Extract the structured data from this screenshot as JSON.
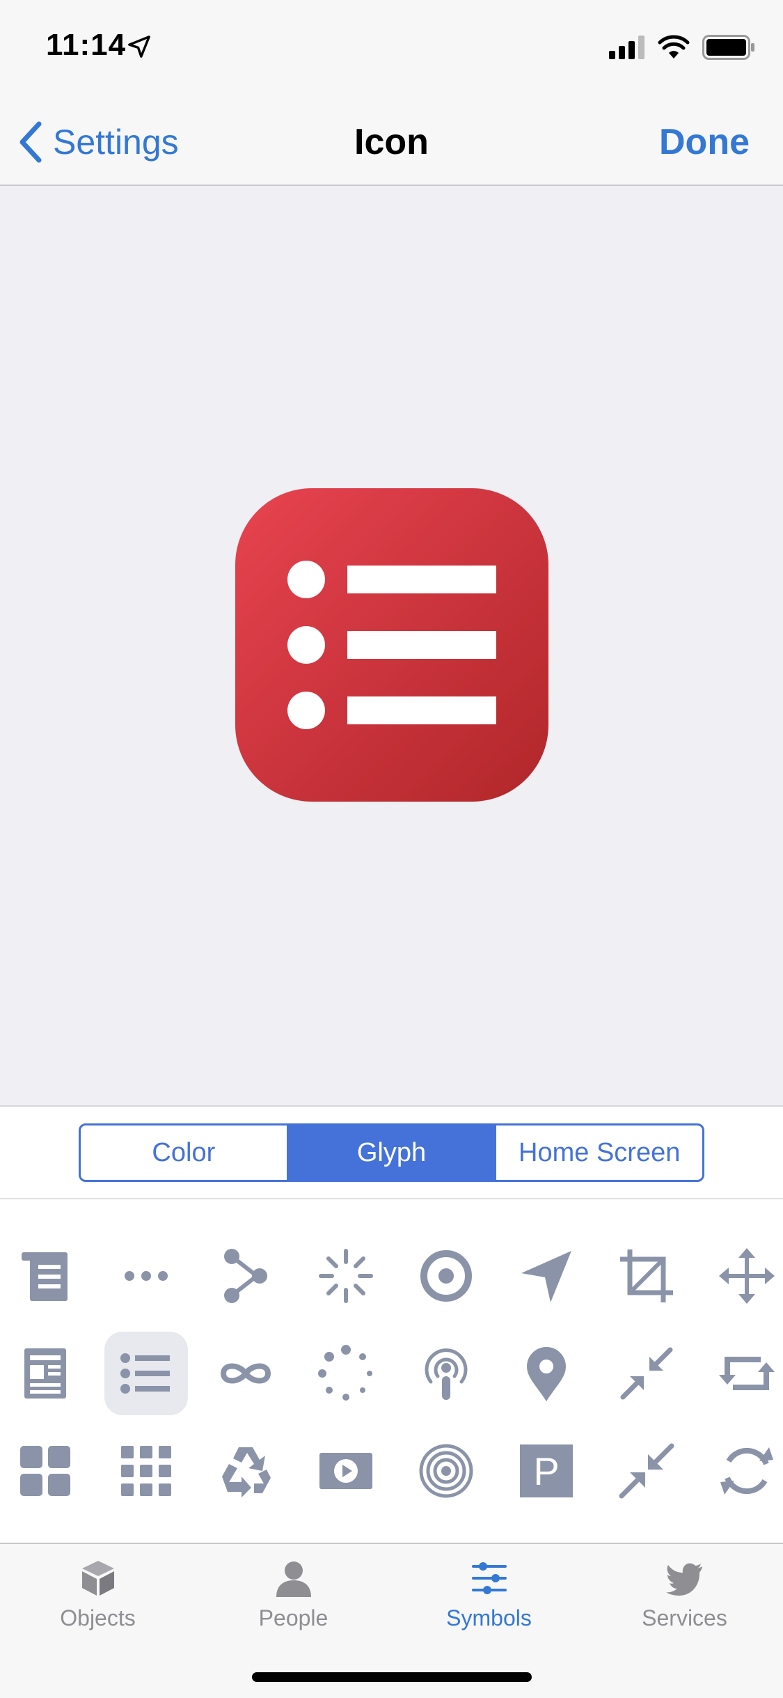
{
  "status": {
    "time": "11:14"
  },
  "nav": {
    "back_label": "Settings",
    "title": "Icon",
    "done_label": "Done"
  },
  "preview": {
    "icon_glyph": "list-bullet-icon",
    "gradient": [
      "#e84450",
      "#b0272a"
    ]
  },
  "segments": [
    {
      "label": "Color",
      "active": false
    },
    {
      "label": "Glyph",
      "active": true
    },
    {
      "label": "Home Screen",
      "active": false
    }
  ],
  "glyphs": [
    [
      "scroll-document-icon",
      "ellipsis-icon",
      "share-nodes-icon",
      "loading-spinner-icon",
      "target-icon",
      "location-arrow-icon",
      "crop-icon",
      "move-arrows-icon"
    ],
    [
      "newspaper-icon",
      "list-bullet-icon",
      "infinity-icon",
      "dotted-circle-icon",
      "podcast-icon",
      "map-pin-icon",
      "compress-arrows-icon",
      "retweet-icon"
    ],
    [
      "grid-large-icon",
      "grid-small-icon",
      "recycle-icon",
      "video-play-icon",
      "concentric-circles-icon",
      "parking-icon",
      "collapse-arrows-icon",
      "refresh-icon"
    ]
  ],
  "selected_glyph": "list-bullet-icon",
  "parking_letter": "P",
  "tabs": [
    {
      "label": "Objects",
      "icon": "cube-icon",
      "active": false
    },
    {
      "label": "People",
      "icon": "person-icon",
      "active": false
    },
    {
      "label": "Symbols",
      "icon": "sliders-icon",
      "active": true
    },
    {
      "label": "Services",
      "icon": "twitter-bird-icon",
      "active": false
    }
  ],
  "colors": {
    "accent": "#3478d6",
    "segment": "#4472d9",
    "glyph": "#8a93a8"
  }
}
